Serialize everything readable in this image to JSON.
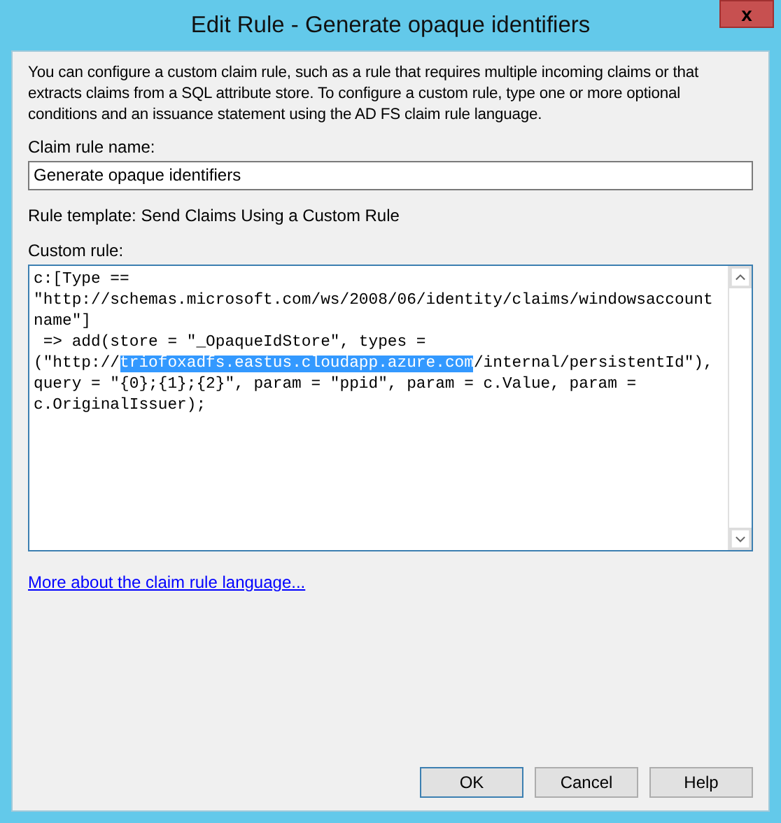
{
  "window": {
    "title": "Edit Rule - Generate opaque identifiers",
    "close_button": "x"
  },
  "description": "You can configure a custom claim rule, such as a rule that requires multiple incoming claims or that extracts claims from a SQL attribute store. To configure a custom rule, type one or more optional conditions and an issuance statement using the AD FS claim rule language.",
  "claim_rule_name": {
    "label": "Claim rule name:",
    "value": "Generate opaque identifiers"
  },
  "rule_template": "Rule template: Send Claims Using a Custom Rule",
  "custom_rule": {
    "label": "Custom rule:",
    "lines": [
      [
        {
          "text": "c:[Type ==",
          "selected": false
        }
      ],
      [
        {
          "text": "\"http://schemas.microsoft.com/ws/2008/06/identity/claims/windowsaccount",
          "selected": false
        }
      ],
      [
        {
          "text": "name\"]",
          "selected": false
        }
      ],
      [
        {
          "text": " => add(store = \"_OpaqueIdStore\", types =",
          "selected": false
        }
      ],
      [
        {
          "text": "(\"http://",
          "selected": false
        },
        {
          "text": "triofoxadfs.eastus.cloudapp.azure.com",
          "selected": true
        },
        {
          "text": "/internal/persistentId\"),",
          "selected": false
        }
      ],
      [
        {
          "text": "query = \"{0};{1};{2}\", param = \"ppid\", param = c.Value, param =",
          "selected": false
        }
      ],
      [
        {
          "text": "c.OriginalIssuer);",
          "selected": false
        }
      ]
    ]
  },
  "link": "More about the claim rule language...",
  "buttons": [
    {
      "label": "OK",
      "default": true
    },
    {
      "label": "Cancel",
      "default": false
    },
    {
      "label": "Help",
      "default": false
    }
  ]
}
